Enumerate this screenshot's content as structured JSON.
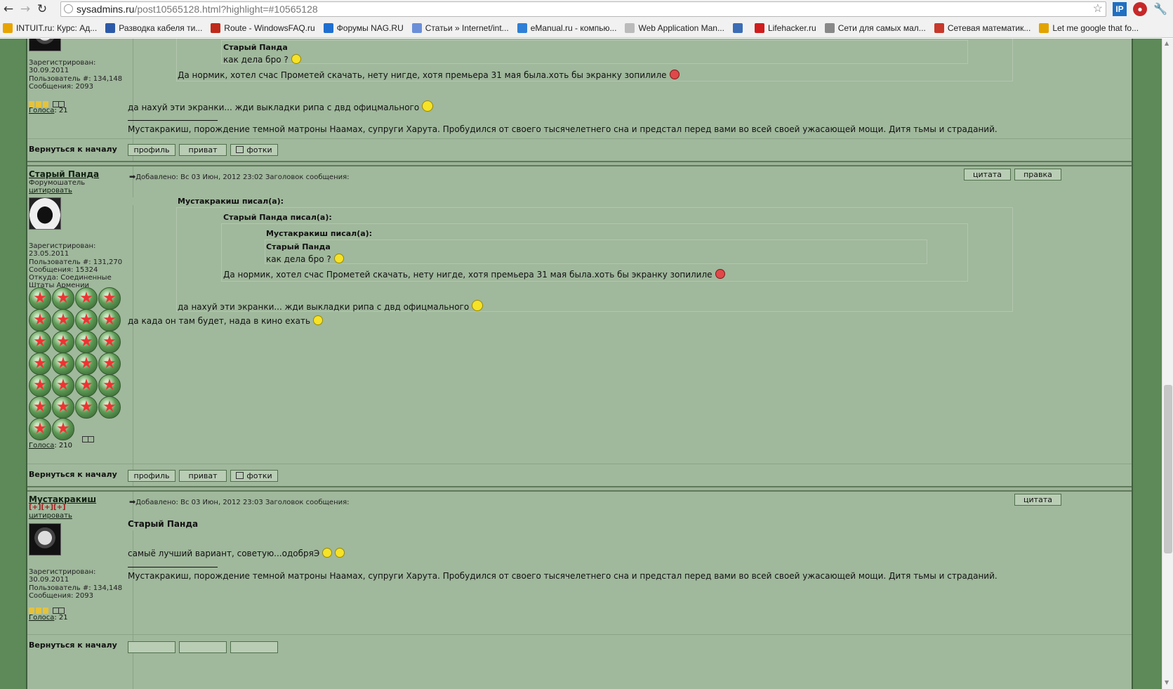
{
  "browser": {
    "url_host": "sysadmins.ru",
    "url_path": "/post10565128.html?highlight=#10565128",
    "extensions": [
      "IP"
    ],
    "bookmarks": [
      {
        "label": "INTUIT.ru: Курс: Ад...",
        "color": "#e8a400"
      },
      {
        "label": "Разводка кабеля ти...",
        "color": "#2d5aa8"
      },
      {
        "label": "Route - WindowsFAQ.ru",
        "color": "#c02a1a"
      },
      {
        "label": "Форумы NAG.RU",
        "color": "#1f6fd0"
      },
      {
        "label": "Статьи » Internet/int...",
        "color": "#6a8fd8"
      },
      {
        "label": "eManual.ru - компью...",
        "color": "#2f7fd6"
      },
      {
        "label": "Web Application Man...",
        "color": "#bbbbbb"
      },
      {
        "label": "",
        "color": "#3b6db5"
      },
      {
        "label": "Lifehacker.ru",
        "color": "#d01d1d"
      },
      {
        "label": "Сети для самых мал...",
        "color": "#888888"
      },
      {
        "label": "Сетевая математик...",
        "color": "#c8382b"
      },
      {
        "label": "Let me google that fo...",
        "color": "#e2a300"
      }
    ]
  },
  "post1": {
    "user": {
      "registered_label": "Зарегистрирован:",
      "registered": "30.09.2011",
      "user_num": "Пользователь #: 134,148",
      "messages": "Сообщения: 2093",
      "votes_label": "Голоса",
      "votes": ": 21"
    },
    "quote_author": "Старый Панда",
    "quote_line": "как дела бро ?",
    "reply_line": "Да нормик, хотел счас Прометей скачать, нету нигде, хотя премьера 31 мая была.хоть бы экранку зопилиле",
    "text": "да нахуй эти экранки... жди выкладки рипа с двд офицмального",
    "signature": "Мустакракиш, порождение темной матроны Наамах, супруги Харута. Пробудился от своего тысячелетнего сна и предстал перед вами во всей своей ужасающей мощи. Дитя тьмы и страданий."
  },
  "buttons": {
    "back_to_top": "Вернуться к началу",
    "profile": "профиль",
    "private": "приват",
    "photos": "фотки",
    "quote": "цитата",
    "edit": "правка"
  },
  "post2": {
    "user": {
      "name": "Старый Панда",
      "title": "Форумошатель",
      "quote_link": "цитировать",
      "registered_label": "Зарегистрирован:",
      "registered": "23.05.2011",
      "user_num": "Пользователь #: 131,270",
      "messages": "Сообщения: 15324",
      "from": "Откуда: Соединенные",
      "from2": "Штаты Армении",
      "votes_label": "Голоса",
      "votes": ": 210"
    },
    "meta": "Добавлено: Вс 03 Июн, 2012 23:02    Заголовок сообщения:",
    "q1_author": "Мустакракиш писал(а):",
    "q2_author": "Старый Панда писал(а):",
    "q3_author": "Мустакракиш писал(а):",
    "q4_author": "Старый Панда",
    "q4_line": "как дела бро ?",
    "q3_reply": "Да нормик, хотел счас Прометей скачать, нету нигде, хотя премьера 31 мая была.хоть бы экранку зопилиле",
    "q1_reply": "да нахуй эти экранки... жди выкладки рипа с двд офицмального",
    "text": "да када он там будет, нада в кино ехать"
  },
  "post3": {
    "user": {
      "name": "Мустакракиш",
      "rank": "[+][+][+]",
      "quote_link": "цитировать",
      "registered_label": "Зарегистрирован:",
      "registered": "30.09.2011",
      "user_num": "Пользователь #: 134,148",
      "messages": "Сообщения: 2093",
      "votes_label": "Голоса",
      "votes": ": 21"
    },
    "meta": "Добавлено: Вс 03 Июн, 2012 23:03    Заголовок сообщения:",
    "addressee": "Старый Панда",
    "text": "самыё лучший вариант, советую...одобряЭ",
    "signature": "Мустакракиш, порождение темной матроны Наамах, супруги Харута. Пробудился от своего тысячелетнего сна и предстал перед вами во всей своей ужасающей мощи. Дитя тьмы и страданий."
  },
  "footer_partial": {
    "back_to_top": "Вернуться к началу"
  }
}
